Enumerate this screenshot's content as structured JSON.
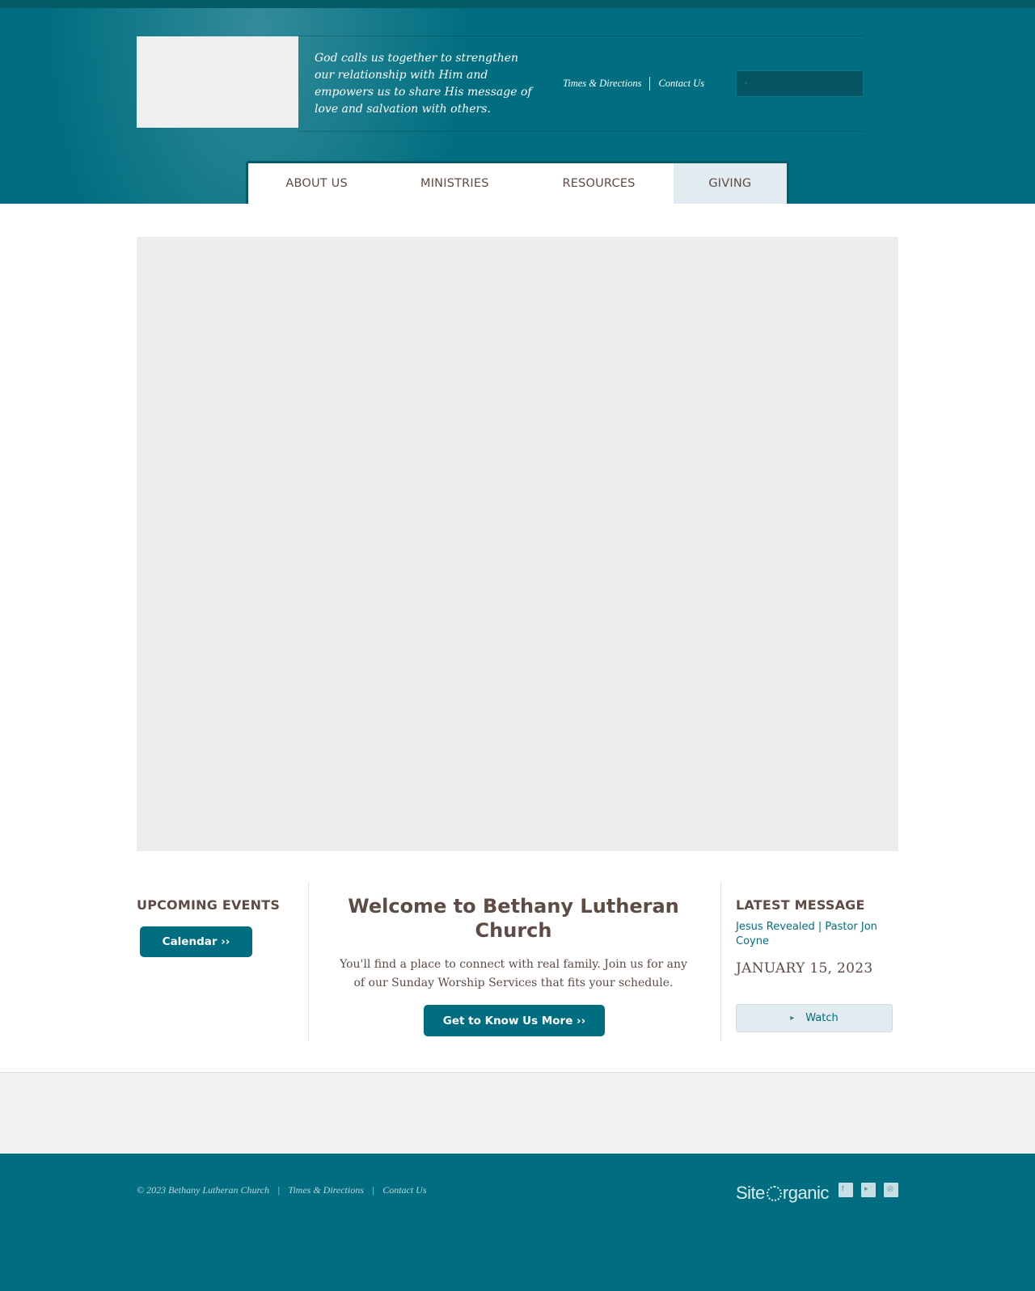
{
  "header": {
    "tagline": "God calls us together to strengthen our relationship with Him and empowers us to share His message of love and salvation with others.",
    "top_links": [
      "Times & Directions",
      "Contact Us"
    ],
    "search_icon": "search-icon"
  },
  "nav": {
    "items": [
      "ABOUT US",
      "MINISTRIES",
      "RESOURCES",
      "GIVING"
    ],
    "active_index": 3
  },
  "events": {
    "title": "UPCOMING EVENTS",
    "calendar_button": "Calendar ››"
  },
  "welcome": {
    "title": "Welcome to  Bethany Lutheran Church",
    "text": "You'll find a place to connect with real family. Join us for any of our Sunday Worship Services that fits your schedule.",
    "button": "Get to Know Us More ››"
  },
  "message": {
    "title": "LATEST MESSAGE",
    "link": "Jesus Revealed | Pastor Jon Coyne",
    "date": "JANUARY 15, 2023",
    "watch_label": "Watch",
    "watch_icon": "video-icon"
  },
  "footer": {
    "copyright": "© 2023 Bethany Lutheran Church",
    "links": [
      "Times & Directions",
      "Contact Us"
    ],
    "credit_left": "Site",
    "credit_right": "rganic",
    "social_icons": [
      "facebook-icon",
      "youtube-icon",
      "instagram-icon"
    ]
  },
  "colors": {
    "brand_teal": "#006e80",
    "dark_teal": "#045a67",
    "text_brown": "#5e4b43",
    "active_tab": "#e2ebef"
  }
}
